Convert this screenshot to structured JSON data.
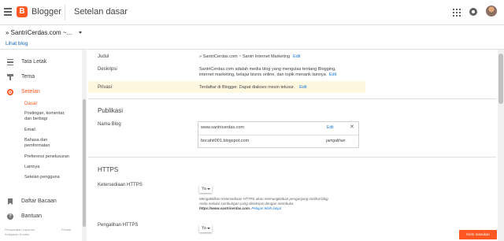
{
  "topbar": {
    "app_name": "Blogger",
    "page_title": "Setelan dasar"
  },
  "blog": {
    "selector_label": "» SantriCerdas.com ~...",
    "view_blog": "Lihat blog"
  },
  "sidebar": {
    "items": [
      {
        "label": "Tata Letak",
        "icon": "layout-icon"
      },
      {
        "label": "Tema",
        "icon": "theme-icon"
      },
      {
        "label": "Setelan",
        "icon": "settings-icon"
      },
      {
        "label": "Daftar Bacaan",
        "icon": "bookmark-icon"
      },
      {
        "label": "Bantuan",
        "icon": "help-icon"
      }
    ],
    "subitems": [
      "Dasar",
      "Postingan, komentar,",
      "dan berbagi",
      "Email",
      "Bahasa dan",
      "pemformatan",
      "Preferensi penelusuran",
      "Lainnya",
      "Setelan pengguna"
    ],
    "footer": {
      "terms": "Persyaratan Layanan",
      "privacy": "Privasi",
      "content_policy": "Kebijakan Konten"
    }
  },
  "main": {
    "rows": {
      "judul": {
        "label": "Judul",
        "value": "» SantriCerdas.com ~ Santri Internet Marketing",
        "edit": "Edit"
      },
      "deskripsi": {
        "label": "Deskripsi",
        "value_line1": "SantriCerdas.com adalah media blog yang mengulas tentang Blogging,",
        "value_line2": "internet marketing, belajar bisnis online, dan topik menarik lainnya",
        "edit": "Edit"
      },
      "privasi": {
        "label": "Privasi",
        "value": "Terdaftar di Blogger. Dapat diakses mesin telusur.",
        "edit": "Edit"
      }
    },
    "publikasi": {
      "title": "Publikasi",
      "label": "Nama Blog",
      "domain": "www.santricerdas.com",
      "domain_edit": "Edit",
      "blogspot": "bocahit001.blogspot.com",
      "blogspot_status": "pengalihan"
    },
    "https": {
      "title": "HTTPS",
      "availability_label": "Ketersediaan HTTPS",
      "availability_value": "Ya",
      "desc_line1": "Mengaktifkan Ketersediaan HTTPS akan memungkinkan pengunjung melihat blog",
      "desc_line2": "Anda melalui sambungan yang dienkripsi dengan membuka",
      "desc_url": "https://www.santricerdas.com.",
      "desc_link": "Pelajari lebih lanjut",
      "redirect_label": "Pengalihan HTTPS",
      "redirect_value": "Ya"
    }
  },
  "feedback_button": "Kirim masukan",
  "colors": {
    "accent": "#ff5722",
    "link": "#1976d2",
    "privacy_highlight": "#fff8e1"
  }
}
